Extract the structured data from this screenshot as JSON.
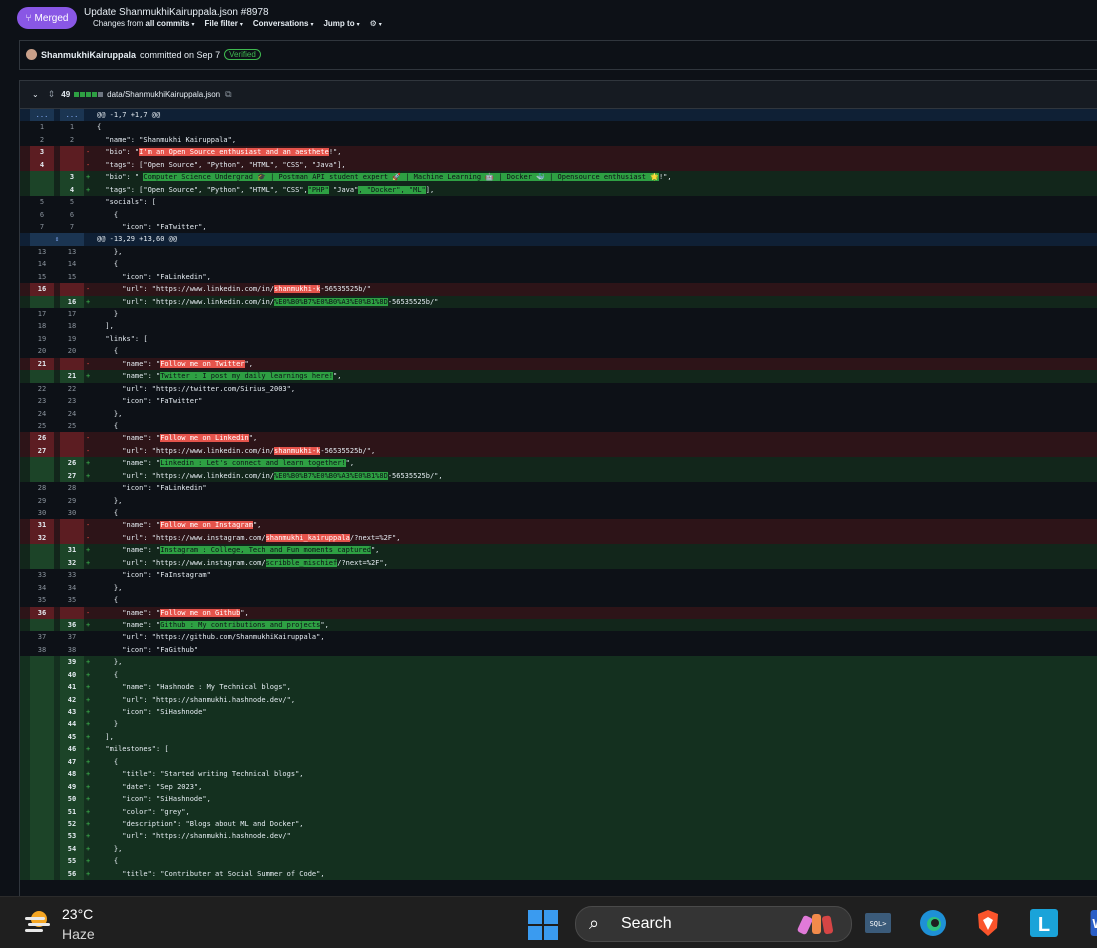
{
  "header": {
    "badge": "Merged",
    "title": "Update ShanmukhiKairuppala.json",
    "number": "#8978",
    "toolbar": {
      "changes_prefix": "Changes from",
      "changes_value": "all commits",
      "file_filter": "File filter",
      "conversations": "Conversations",
      "jump_to": "Jump to"
    }
  },
  "commit": {
    "author": "ShanmukhiKairuppala",
    "text": "committed on Sep 7",
    "verified": "Verified"
  },
  "file": {
    "changes": "49",
    "path": "data/ShanmukhiKairuppala.json"
  },
  "diff_rows": [
    {
      "t": "hunk",
      "a": "...",
      "b": "...",
      "c": "@@ -1,7 +1,7 @@"
    },
    {
      "t": "ctx",
      "a": "1",
      "b": "1",
      "c": "{"
    },
    {
      "t": "ctx",
      "a": "2",
      "b": "2",
      "c": "  \"name\": \"Shanmukhi Kairuppala\","
    },
    {
      "t": "del",
      "a": "3",
      "b": "",
      "c": "  \"bio\": \"",
      "h": "I'm an Open Source enthusiast and an aesthete",
      "c2": "!\","
    },
    {
      "t": "del",
      "a": "4",
      "b": "",
      "c": "  \"tags\": [\"Open Source\", \"Python\", \"HTML\", \"CSS\", \"Java\"],"
    },
    {
      "t": "add",
      "a": "",
      "b": "3",
      "c": "  \"bio\": \" ",
      "h": "Computer Science Undergrad 🎓 | Postman API student expert 🚀 | Machine Learning 🤖 | Docker 🐳 | Opensource enthusiast 🌟",
      "c2": "!\","
    },
    {
      "t": "add",
      "a": "",
      "b": "4",
      "c": "  \"tags\": [\"Open Source\", \"Python\", \"HTML\", \"CSS\",",
      "h": "\"PHP\"",
      "c2": " \"Java\"",
      "h2": ", \"Docker\", \"ML\"",
      "c3": "],"
    },
    {
      "t": "ctx",
      "a": "5",
      "b": "5",
      "c": "  \"socials\": ["
    },
    {
      "t": "ctx",
      "a": "6",
      "b": "6",
      "c": "    {"
    },
    {
      "t": "ctx",
      "a": "7",
      "b": "7",
      "c": "      \"icon\": \"FaTwitter\","
    },
    {
      "t": "hunk",
      "a": "",
      "b": "",
      "c": "@@ -13,29 +13,60 @@"
    },
    {
      "t": "ctx",
      "a": "13",
      "b": "13",
      "c": "    },"
    },
    {
      "t": "ctx",
      "a": "14",
      "b": "14",
      "c": "    {"
    },
    {
      "t": "ctx",
      "a": "15",
      "b": "15",
      "c": "      \"icon\": \"FaLinkedin\","
    },
    {
      "t": "del",
      "a": "16",
      "b": "",
      "c": "      \"url\": \"https://www.linkedin.com/in/",
      "h": "shanmukhi-k",
      "c2": "-56535525b/\""
    },
    {
      "t": "add",
      "a": "",
      "b": "16",
      "c": "      \"url\": \"https://www.linkedin.com/in/",
      "h": "%E0%B0%B7%E0%B0%A3%E0%B1%8D",
      "c2": "-56535525b/\""
    },
    {
      "t": "ctx",
      "a": "17",
      "b": "17",
      "c": "    }"
    },
    {
      "t": "ctx",
      "a": "18",
      "b": "18",
      "c": "  ],"
    },
    {
      "t": "ctx",
      "a": "19",
      "b": "19",
      "c": "  \"links\": ["
    },
    {
      "t": "ctx",
      "a": "20",
      "b": "20",
      "c": "    {"
    },
    {
      "t": "del",
      "a": "21",
      "b": "",
      "c": "      \"name\": \"",
      "h": "Follow me on Twitter",
      "c2": "\","
    },
    {
      "t": "add",
      "a": "",
      "b": "21",
      "c": "      \"name\": \"",
      "h": "Twitter : I post my daily learnings here!",
      "c2": "\","
    },
    {
      "t": "ctx",
      "a": "22",
      "b": "22",
      "c": "      \"url\": \"https://twitter.com/Sirius_2003\","
    },
    {
      "t": "ctx",
      "a": "23",
      "b": "23",
      "c": "      \"icon\": \"FaTwitter\""
    },
    {
      "t": "ctx",
      "a": "24",
      "b": "24",
      "c": "    },"
    },
    {
      "t": "ctx",
      "a": "25",
      "b": "25",
      "c": "    {"
    },
    {
      "t": "del",
      "a": "26",
      "b": "",
      "c": "      \"name\": \"",
      "h": "Follow me on Linkedin",
      "c2": "\","
    },
    {
      "t": "del",
      "a": "27",
      "b": "",
      "c": "      \"url\": \"https://www.linkedin.com/in/",
      "h": "shanmukhi-k",
      "c2": "-56535525b/\","
    },
    {
      "t": "add",
      "a": "",
      "b": "26",
      "c": "      \"name\": \"",
      "h": "Linkedin : Let's connect and learn together!",
      "c2": "\","
    },
    {
      "t": "add",
      "a": "",
      "b": "27",
      "c": "      \"url\": \"https://www.linkedin.com/in/",
      "h": "%E0%B0%B7%E0%B0%A3%E0%B1%8D",
      "c2": "-56535525b/\","
    },
    {
      "t": "ctx",
      "a": "28",
      "b": "28",
      "c": "      \"icon\": \"FaLinkedin\""
    },
    {
      "t": "ctx",
      "a": "29",
      "b": "29",
      "c": "    },"
    },
    {
      "t": "ctx",
      "a": "30",
      "b": "30",
      "c": "    {"
    },
    {
      "t": "del",
      "a": "31",
      "b": "",
      "c": "      \"name\": \"",
      "h": "Follow me on Instagram",
      "c2": "\","
    },
    {
      "t": "del",
      "a": "32",
      "b": "",
      "c": "      \"url\": \"https://www.instagram.com/",
      "h": "shanmukhi_kairuppala",
      "c2": "/?next=%2F\","
    },
    {
      "t": "add",
      "a": "",
      "b": "31",
      "c": "      \"name\": \"",
      "h": "Instagram : College, Tech and Fun moments captured",
      "c2": "\","
    },
    {
      "t": "add",
      "a": "",
      "b": "32",
      "c": "      \"url\": \"https://www.instagram.com/",
      "h": "scribble_mischief",
      "c2": "/?next=%2F\","
    },
    {
      "t": "ctx",
      "a": "33",
      "b": "33",
      "c": "      \"icon\": \"FaInstagram\""
    },
    {
      "t": "ctx",
      "a": "34",
      "b": "34",
      "c": "    },"
    },
    {
      "t": "ctx",
      "a": "35",
      "b": "35",
      "c": "    {"
    },
    {
      "t": "del",
      "a": "36",
      "b": "",
      "c": "      \"name\": \"",
      "h": "Follow me on Github",
      "c2": "\","
    },
    {
      "t": "add",
      "a": "",
      "b": "36",
      "c": "      \"name\": \"",
      "h": "Github : My contributions and projects",
      "c2": "\","
    },
    {
      "t": "ctx",
      "a": "37",
      "b": "37",
      "c": "      \"url\": \"https://github.com/ShanmukhiKairuppala\","
    },
    {
      "t": "ctx",
      "a": "38",
      "b": "38",
      "c": "      \"icon\": \"FaGithub\""
    },
    {
      "t": "addp",
      "a": "",
      "b": "39",
      "c": "    },"
    },
    {
      "t": "addp",
      "a": "",
      "b": "40",
      "c": "    {"
    },
    {
      "t": "addp",
      "a": "",
      "b": "41",
      "c": "      \"name\": \"Hashnode : My Technical blogs\","
    },
    {
      "t": "addp",
      "a": "",
      "b": "42",
      "c": "      \"url\": \"https://shanmukhi.hashnode.dev/\","
    },
    {
      "t": "addp",
      "a": "",
      "b": "43",
      "c": "      \"icon\": \"SiHashnode\""
    },
    {
      "t": "addp",
      "a": "",
      "b": "44",
      "c": "    }"
    },
    {
      "t": "addp",
      "a": "",
      "b": "45",
      "c": "  ],"
    },
    {
      "t": "addp",
      "a": "",
      "b": "46",
      "c": "  \"milestones\": ["
    },
    {
      "t": "addp",
      "a": "",
      "b": "47",
      "c": "    {"
    },
    {
      "t": "addp",
      "a": "",
      "b": "48",
      "c": "      \"title\": \"Started writing Technical blogs\","
    },
    {
      "t": "addp",
      "a": "",
      "b": "49",
      "c": "      \"date\": \"Sep 2023\","
    },
    {
      "t": "addp",
      "a": "",
      "b": "50",
      "c": "      \"icon\": \"SiHashnode\","
    },
    {
      "t": "addp",
      "a": "",
      "b": "51",
      "c": "      \"color\": \"grey\","
    },
    {
      "t": "addp",
      "a": "",
      "b": "52",
      "c": "      \"description\": \"Blogs about ML and Docker\","
    },
    {
      "t": "addp",
      "a": "",
      "b": "53",
      "c": "      \"url\": \"https://shanmukhi.hashnode.dev/\""
    },
    {
      "t": "addp",
      "a": "",
      "b": "54",
      "c": "    },"
    },
    {
      "t": "addp",
      "a": "",
      "b": "55",
      "c": "    {"
    },
    {
      "t": "addp",
      "a": "",
      "b": "56",
      "c": "      \"title\": \"Contributer at Social Summer of Code\","
    }
  ],
  "taskbar": {
    "temperature": "23°C",
    "condition": "Haze",
    "search_label": "Search"
  },
  "colors": {
    "merged": "#8957e5",
    "deleted_bg": "#2d1418",
    "added_bg": "#12261b",
    "hunk_bg": "#0f2035"
  }
}
